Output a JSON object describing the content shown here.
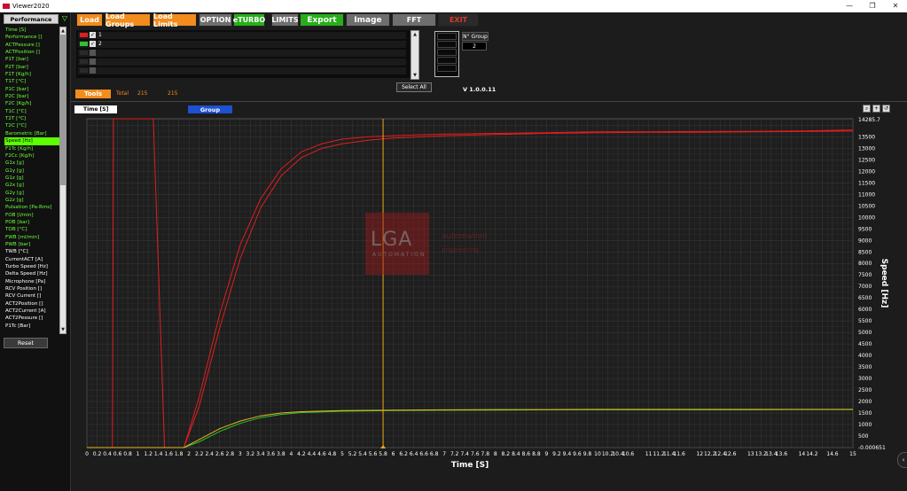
{
  "window": {
    "title": "Viewer2020",
    "minimize": "—",
    "maximize": "❐",
    "close": "✕"
  },
  "sidebar": {
    "dropdown": "Performance",
    "filter_icon": "▽",
    "reset": "Reset",
    "channels": [
      {
        "label": "Time [S]",
        "color": "green"
      },
      {
        "label": "Performance []",
        "color": "green"
      },
      {
        "label": "ACTPessure []",
        "color": "green"
      },
      {
        "label": "ACTPosition []",
        "color": "green"
      },
      {
        "label": "P1T [bar]",
        "color": "green"
      },
      {
        "label": "P2T [bar]",
        "color": "green"
      },
      {
        "label": "F1T [Kg/h]",
        "color": "green"
      },
      {
        "label": "T1T [°C]",
        "color": "green"
      },
      {
        "label": "P1C [bar]",
        "color": "green"
      },
      {
        "label": "P2C [bar]",
        "color": "green"
      },
      {
        "label": "F2C [Kg/h]",
        "color": "green"
      },
      {
        "label": "T1C [°C]",
        "color": "green"
      },
      {
        "label": "T2T [°C]",
        "color": "green"
      },
      {
        "label": "T2C [°C]",
        "color": "green"
      },
      {
        "label": "Barometric [Bar]",
        "color": "green"
      },
      {
        "label": "Speed [Hz]",
        "color": "selected"
      },
      {
        "label": "F1Tc [Kg/h]",
        "color": "green"
      },
      {
        "label": "F2Cc [Kg/h]",
        "color": "green"
      },
      {
        "label": "G1x [g]",
        "color": "green"
      },
      {
        "label": "G1y [g]",
        "color": "green"
      },
      {
        "label": "G1z [g]",
        "color": "green"
      },
      {
        "label": "G2x [g]",
        "color": "green"
      },
      {
        "label": "G2y [g]",
        "color": "green"
      },
      {
        "label": "G2z [g]",
        "color": "green"
      },
      {
        "label": "Pulsation [Pa-Rms]",
        "color": "green"
      },
      {
        "label": "FOB [l/min]",
        "color": "green"
      },
      {
        "label": "POB [bar]",
        "color": "green"
      },
      {
        "label": "TOB [°C]",
        "color": "green"
      },
      {
        "label": "FWB [ml/min]",
        "color": "green"
      },
      {
        "label": "PWB [bar]",
        "color": "green"
      },
      {
        "label": "TWB [°C]",
        "color": "white"
      },
      {
        "label": "CurrentACT [A]",
        "color": "white"
      },
      {
        "label": "Turbo Speed [Hz]",
        "color": "white"
      },
      {
        "label": "Delta Speed [Hz]",
        "color": "white"
      },
      {
        "label": "Microphone [Pa]",
        "color": "white"
      },
      {
        "label": "RCV Position []",
        "color": "white"
      },
      {
        "label": "RCV Current []",
        "color": "white"
      },
      {
        "label": "ACT2Position []",
        "color": "white"
      },
      {
        "label": "ACT2Current [A]",
        "color": "white"
      },
      {
        "label": "ACT2Pessure []",
        "color": "white"
      },
      {
        "label": "P1Tc [Bar]",
        "color": "white"
      }
    ]
  },
  "toolbar": {
    "load": "Load",
    "load_groups": "Load Groups",
    "load_limits": "Load Limits",
    "option": "OPTION",
    "eturbo": "eTURBO",
    "limits": "LIMITS",
    "export": "Export",
    "image": "Image",
    "fft": "FFT",
    "exit": "EXIT"
  },
  "series": [
    {
      "label": "1",
      "color": "#e01e1e",
      "checked": "✓"
    },
    {
      "label": "2",
      "color": "#2ec22e",
      "checked": "✓"
    },
    {
      "label": "",
      "color": "#2a2a2a",
      "checked": ""
    },
    {
      "label": "",
      "color": "#2a2a2a",
      "checked": ""
    },
    {
      "label": "",
      "color": "#2a2a2a",
      "checked": ""
    }
  ],
  "select_all": "Select All",
  "group": {
    "label": "N° Group",
    "value": "2"
  },
  "version": "V 1.0.0.11",
  "tools": {
    "label": "Tools",
    "total_label": "Total",
    "total_a": "215",
    "total_b": "215"
  },
  "plot": {
    "x_selector": "Time [S]",
    "group_selector": "Group",
    "tool_icons": [
      "zoom-icon",
      "plus-icon",
      "reset-icon"
    ]
  },
  "watermark": {
    "logo": "LGA",
    "sub": "AUTOMATION",
    "tag1": "automation",
    "tag2": "engineering"
  },
  "colors": {
    "accent_orange": "#f28c1c",
    "export_green": "#27ae1a",
    "series_red": "#e01e1e",
    "series_green": "#2ec22e",
    "cursor": "#f2a31c"
  },
  "chart_data": {
    "type": "line",
    "xlabel": "Time [S]",
    "ylabel": "Speed [Hz]",
    "xlim": [
      0,
      15
    ],
    "ylim": [
      -0.000651,
      14285.7
    ],
    "y_top_label": "14285.7",
    "y_bottom_label": "-0.000651",
    "x_ticks": [
      "0",
      "0.2",
      "0.4",
      "0.6",
      "0.8",
      "1",
      "1.2",
      "1.4",
      "1.6",
      "1.8",
      "2",
      "2.2",
      "2.4",
      "2.6",
      "2.8",
      "3",
      "3.2",
      "3.4",
      "3.6",
      "3.8",
      "4",
      "4.2",
      "4.4",
      "4.6",
      "4.8",
      "5",
      "5.2",
      "5.4",
      "5.6",
      "5.8",
      "6",
      "6.2",
      "6.4",
      "6.6",
      "6.8",
      "7",
      "7.2",
      "7.4",
      "7.6",
      "7.8",
      "8",
      "8.2",
      "8.4",
      "8.6",
      "8.8",
      "9",
      "9.2",
      "9.4",
      "9.6",
      "9.8",
      "10",
      "10.2",
      "10.4",
      "10.6",
      "11",
      "11.2",
      "11.4",
      "11.6",
      "12",
      "12.2",
      "12.4",
      "12.6",
      "13",
      "13.2",
      "13.4",
      "13.6",
      "14",
      "14.2",
      "14.6",
      "15"
    ],
    "y_ticks": [
      "500",
      "1000",
      "1500",
      "2000",
      "2500",
      "3000",
      "3500",
      "4000",
      "4500",
      "5000",
      "5500",
      "6000",
      "6500",
      "7000",
      "7500",
      "8000",
      "8500",
      "9000",
      "9500",
      "10000",
      "10500",
      "11000",
      "11500",
      "12000",
      "12500",
      "13000",
      "13500"
    ],
    "cursor_x": 5.8,
    "series": [
      {
        "name": "1",
        "color": "#e01e1e",
        "x": [
          0,
          0.5,
          0.52,
          1.3,
          1.52,
          1.9,
          2.2,
          2.6,
          3.0,
          3.4,
          3.8,
          4.2,
          4.6,
          5.0,
          5.5,
          6.0,
          7.0,
          8.0,
          9.0,
          10.0,
          11.0,
          12.0,
          13.0,
          14.0,
          15.0
        ],
        "y": [
          0,
          0,
          14285.7,
          14285.7,
          0,
          0,
          1800,
          5200,
          8200,
          10400,
          11800,
          12600,
          13000,
          13200,
          13350,
          13450,
          13550,
          13600,
          13650,
          13680,
          13700,
          13700,
          13720,
          13730,
          13750
        ]
      },
      {
        "name": "1b",
        "color": "#e01e1e",
        "x": [
          1.9,
          2.2,
          2.6,
          3.0,
          3.4,
          3.8,
          4.2,
          4.6,
          5.0,
          5.5,
          6.0,
          7.0,
          8.0,
          9.0,
          10.0,
          11.0,
          12.0,
          13.0,
          14.0,
          15.0
        ],
        "y": [
          0,
          2200,
          5800,
          8800,
          10800,
          12100,
          12850,
          13200,
          13400,
          13500,
          13550,
          13620,
          13650,
          13680,
          13720,
          13720,
          13730,
          13740,
          13760,
          13800
        ]
      },
      {
        "name": "2",
        "color": "#2ec22e",
        "x": [
          0,
          1.9,
          2.2,
          2.6,
          3.0,
          3.4,
          3.8,
          4.2,
          5.0,
          6.0,
          7.0,
          8.0,
          9.0,
          10.0,
          11.0,
          12.0,
          13.0,
          14.0,
          15.0
        ],
        "y": [
          0,
          0,
          250,
          700,
          1050,
          1300,
          1440,
          1520,
          1580,
          1610,
          1620,
          1630,
          1640,
          1640,
          1640,
          1640,
          1640,
          1650,
          1650
        ]
      },
      {
        "name": "2b",
        "color": "#e6b81e",
        "x": [
          0,
          1.9,
          2.2,
          2.6,
          3.0,
          3.4,
          3.8,
          4.2,
          5.0,
          6.0,
          7.0,
          8.0,
          9.0,
          10.0,
          11.0,
          12.0,
          13.0,
          14.0,
          15.0
        ],
        "y": [
          0,
          0,
          350,
          820,
          1150,
          1380,
          1500,
          1560,
          1610,
          1630,
          1640,
          1650,
          1650,
          1660,
          1660,
          1660,
          1660,
          1660,
          1660
        ]
      }
    ]
  }
}
